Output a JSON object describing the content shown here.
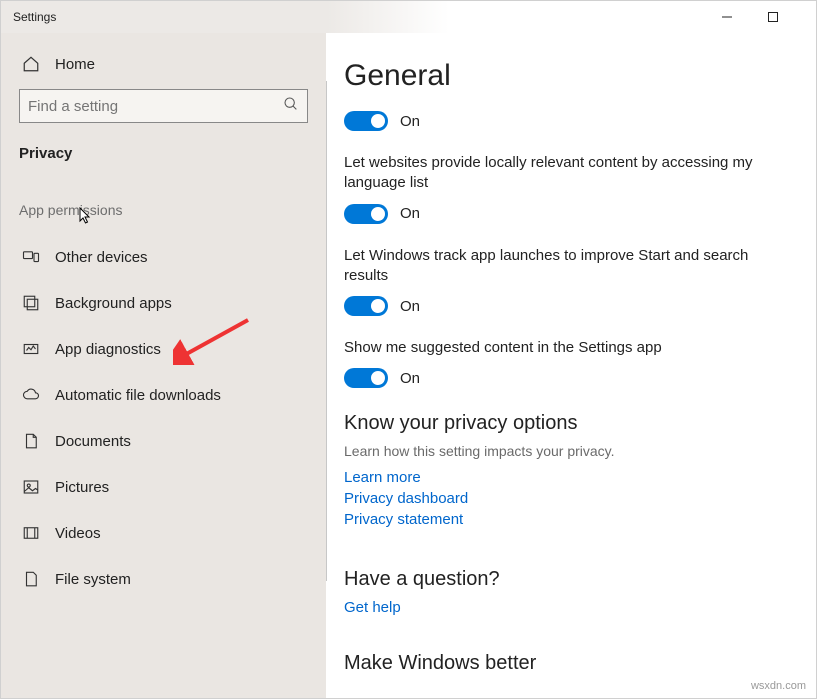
{
  "title": "Settings",
  "sidebar": {
    "home": "Home",
    "search_placeholder": "Find a setting",
    "section": "Privacy",
    "group": "App permissions",
    "items": [
      {
        "label": "Other devices"
      },
      {
        "label": "Background apps"
      },
      {
        "label": "App diagnostics"
      },
      {
        "label": "Automatic file downloads"
      },
      {
        "label": "Documents"
      },
      {
        "label": "Pictures"
      },
      {
        "label": "Videos"
      },
      {
        "label": "File system"
      }
    ]
  },
  "main": {
    "heading": "General",
    "toggles": {
      "t0_state": "On",
      "t1_desc": "Let websites provide locally relevant content by accessing my language list",
      "t1_state": "On",
      "t2_desc": "Let Windows track app launches to improve Start and search results",
      "t2_state": "On",
      "t3_desc": "Show me suggested content in the Settings app",
      "t3_state": "On"
    },
    "privacy_heading": "Know your privacy options",
    "privacy_sub": "Learn how this setting impacts your privacy.",
    "links": {
      "learn_more": "Learn more",
      "dashboard": "Privacy dashboard",
      "statement": "Privacy statement"
    },
    "question_heading": "Have a question?",
    "get_help": "Get help",
    "better_heading": "Make Windows better"
  },
  "watermark": "wsxdn.com"
}
